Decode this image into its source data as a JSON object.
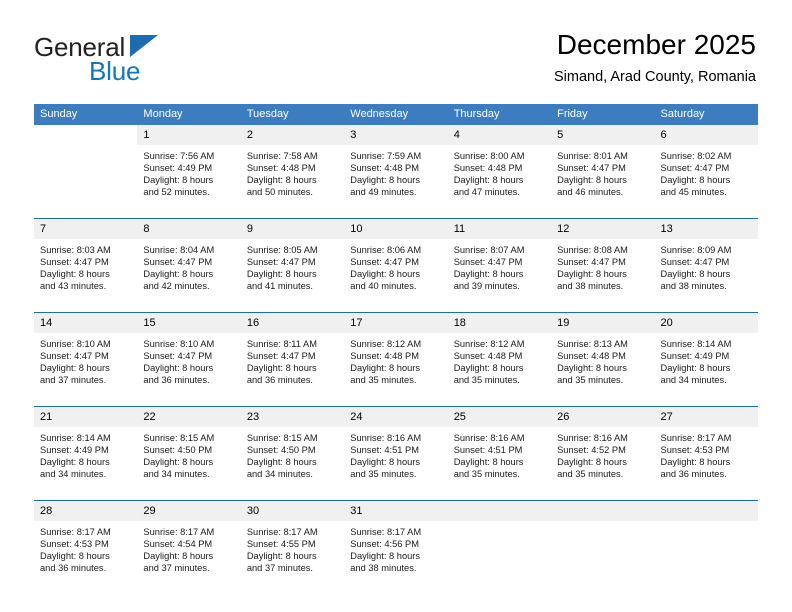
{
  "brand": {
    "name_part1": "General",
    "name_part2": "Blue",
    "flag_icon": "triangle-flag-icon"
  },
  "header": {
    "title": "December 2025",
    "subtitle": "Simand, Arad County, Romania"
  },
  "colors": {
    "header_band": "#3b7dc0",
    "week_separator": "#1b6cb0",
    "daynum_band": "#f0f0f0",
    "brand_blue": "#1278be",
    "text": "#000000"
  },
  "weekday_headers": [
    "Sunday",
    "Monday",
    "Tuesday",
    "Wednesday",
    "Thursday",
    "Friday",
    "Saturday"
  ],
  "weeks": [
    {
      "days": [
        {
          "num": "",
          "empty": true,
          "sunrise": "",
          "sunset": "",
          "daylight_line1": "",
          "daylight_line2": ""
        },
        {
          "num": "1",
          "empty": false,
          "sunrise": "Sunrise: 7:56 AM",
          "sunset": "Sunset: 4:49 PM",
          "daylight_line1": "Daylight: 8 hours",
          "daylight_line2": "and 52 minutes."
        },
        {
          "num": "2",
          "empty": false,
          "sunrise": "Sunrise: 7:58 AM",
          "sunset": "Sunset: 4:48 PM",
          "daylight_line1": "Daylight: 8 hours",
          "daylight_line2": "and 50 minutes."
        },
        {
          "num": "3",
          "empty": false,
          "sunrise": "Sunrise: 7:59 AM",
          "sunset": "Sunset: 4:48 PM",
          "daylight_line1": "Daylight: 8 hours",
          "daylight_line2": "and 49 minutes."
        },
        {
          "num": "4",
          "empty": false,
          "sunrise": "Sunrise: 8:00 AM",
          "sunset": "Sunset: 4:48 PM",
          "daylight_line1": "Daylight: 8 hours",
          "daylight_line2": "and 47 minutes."
        },
        {
          "num": "5",
          "empty": false,
          "sunrise": "Sunrise: 8:01 AM",
          "sunset": "Sunset: 4:47 PM",
          "daylight_line1": "Daylight: 8 hours",
          "daylight_line2": "and 46 minutes."
        },
        {
          "num": "6",
          "empty": false,
          "sunrise": "Sunrise: 8:02 AM",
          "sunset": "Sunset: 4:47 PM",
          "daylight_line1": "Daylight: 8 hours",
          "daylight_line2": "and 45 minutes."
        }
      ]
    },
    {
      "days": [
        {
          "num": "7",
          "empty": false,
          "sunrise": "Sunrise: 8:03 AM",
          "sunset": "Sunset: 4:47 PM",
          "daylight_line1": "Daylight: 8 hours",
          "daylight_line2": "and 43 minutes."
        },
        {
          "num": "8",
          "empty": false,
          "sunrise": "Sunrise: 8:04 AM",
          "sunset": "Sunset: 4:47 PM",
          "daylight_line1": "Daylight: 8 hours",
          "daylight_line2": "and 42 minutes."
        },
        {
          "num": "9",
          "empty": false,
          "sunrise": "Sunrise: 8:05 AM",
          "sunset": "Sunset: 4:47 PM",
          "daylight_line1": "Daylight: 8 hours",
          "daylight_line2": "and 41 minutes."
        },
        {
          "num": "10",
          "empty": false,
          "sunrise": "Sunrise: 8:06 AM",
          "sunset": "Sunset: 4:47 PM",
          "daylight_line1": "Daylight: 8 hours",
          "daylight_line2": "and 40 minutes."
        },
        {
          "num": "11",
          "empty": false,
          "sunrise": "Sunrise: 8:07 AM",
          "sunset": "Sunset: 4:47 PM",
          "daylight_line1": "Daylight: 8 hours",
          "daylight_line2": "and 39 minutes."
        },
        {
          "num": "12",
          "empty": false,
          "sunrise": "Sunrise: 8:08 AM",
          "sunset": "Sunset: 4:47 PM",
          "daylight_line1": "Daylight: 8 hours",
          "daylight_line2": "and 38 minutes."
        },
        {
          "num": "13",
          "empty": false,
          "sunrise": "Sunrise: 8:09 AM",
          "sunset": "Sunset: 4:47 PM",
          "daylight_line1": "Daylight: 8 hours",
          "daylight_line2": "and 38 minutes."
        }
      ]
    },
    {
      "days": [
        {
          "num": "14",
          "empty": false,
          "sunrise": "Sunrise: 8:10 AM",
          "sunset": "Sunset: 4:47 PM",
          "daylight_line1": "Daylight: 8 hours",
          "daylight_line2": "and 37 minutes."
        },
        {
          "num": "15",
          "empty": false,
          "sunrise": "Sunrise: 8:10 AM",
          "sunset": "Sunset: 4:47 PM",
          "daylight_line1": "Daylight: 8 hours",
          "daylight_line2": "and 36 minutes."
        },
        {
          "num": "16",
          "empty": false,
          "sunrise": "Sunrise: 8:11 AM",
          "sunset": "Sunset: 4:47 PM",
          "daylight_line1": "Daylight: 8 hours",
          "daylight_line2": "and 36 minutes."
        },
        {
          "num": "17",
          "empty": false,
          "sunrise": "Sunrise: 8:12 AM",
          "sunset": "Sunset: 4:48 PM",
          "daylight_line1": "Daylight: 8 hours",
          "daylight_line2": "and 35 minutes."
        },
        {
          "num": "18",
          "empty": false,
          "sunrise": "Sunrise: 8:12 AM",
          "sunset": "Sunset: 4:48 PM",
          "daylight_line1": "Daylight: 8 hours",
          "daylight_line2": "and 35 minutes."
        },
        {
          "num": "19",
          "empty": false,
          "sunrise": "Sunrise: 8:13 AM",
          "sunset": "Sunset: 4:48 PM",
          "daylight_line1": "Daylight: 8 hours",
          "daylight_line2": "and 35 minutes."
        },
        {
          "num": "20",
          "empty": false,
          "sunrise": "Sunrise: 8:14 AM",
          "sunset": "Sunset: 4:49 PM",
          "daylight_line1": "Daylight: 8 hours",
          "daylight_line2": "and 34 minutes."
        }
      ]
    },
    {
      "days": [
        {
          "num": "21",
          "empty": false,
          "sunrise": "Sunrise: 8:14 AM",
          "sunset": "Sunset: 4:49 PM",
          "daylight_line1": "Daylight: 8 hours",
          "daylight_line2": "and 34 minutes."
        },
        {
          "num": "22",
          "empty": false,
          "sunrise": "Sunrise: 8:15 AM",
          "sunset": "Sunset: 4:50 PM",
          "daylight_line1": "Daylight: 8 hours",
          "daylight_line2": "and 34 minutes."
        },
        {
          "num": "23",
          "empty": false,
          "sunrise": "Sunrise: 8:15 AM",
          "sunset": "Sunset: 4:50 PM",
          "daylight_line1": "Daylight: 8 hours",
          "daylight_line2": "and 34 minutes."
        },
        {
          "num": "24",
          "empty": false,
          "sunrise": "Sunrise: 8:16 AM",
          "sunset": "Sunset: 4:51 PM",
          "daylight_line1": "Daylight: 8 hours",
          "daylight_line2": "and 35 minutes."
        },
        {
          "num": "25",
          "empty": false,
          "sunrise": "Sunrise: 8:16 AM",
          "sunset": "Sunset: 4:51 PM",
          "daylight_line1": "Daylight: 8 hours",
          "daylight_line2": "and 35 minutes."
        },
        {
          "num": "26",
          "empty": false,
          "sunrise": "Sunrise: 8:16 AM",
          "sunset": "Sunset: 4:52 PM",
          "daylight_line1": "Daylight: 8 hours",
          "daylight_line2": "and 35 minutes."
        },
        {
          "num": "27",
          "empty": false,
          "sunrise": "Sunrise: 8:17 AM",
          "sunset": "Sunset: 4:53 PM",
          "daylight_line1": "Daylight: 8 hours",
          "daylight_line2": "and 36 minutes."
        }
      ]
    },
    {
      "days": [
        {
          "num": "28",
          "empty": false,
          "sunrise": "Sunrise: 8:17 AM",
          "sunset": "Sunset: 4:53 PM",
          "daylight_line1": "Daylight: 8 hours",
          "daylight_line2": "and 36 minutes."
        },
        {
          "num": "29",
          "empty": false,
          "sunrise": "Sunrise: 8:17 AM",
          "sunset": "Sunset: 4:54 PM",
          "daylight_line1": "Daylight: 8 hours",
          "daylight_line2": "and 37 minutes."
        },
        {
          "num": "30",
          "empty": false,
          "sunrise": "Sunrise: 8:17 AM",
          "sunset": "Sunset: 4:55 PM",
          "daylight_line1": "Daylight: 8 hours",
          "daylight_line2": "and 37 minutes."
        },
        {
          "num": "31",
          "empty": false,
          "sunrise": "Sunrise: 8:17 AM",
          "sunset": "Sunset: 4:56 PM",
          "daylight_line1": "Daylight: 8 hours",
          "daylight_line2": "and 38 minutes."
        },
        {
          "num": "",
          "empty": true,
          "sunrise": "",
          "sunset": "",
          "daylight_line1": "",
          "daylight_line2": ""
        },
        {
          "num": "",
          "empty": true,
          "sunrise": "",
          "sunset": "",
          "daylight_line1": "",
          "daylight_line2": ""
        },
        {
          "num": "",
          "empty": true,
          "sunrise": "",
          "sunset": "",
          "daylight_line1": "",
          "daylight_line2": ""
        }
      ]
    }
  ]
}
